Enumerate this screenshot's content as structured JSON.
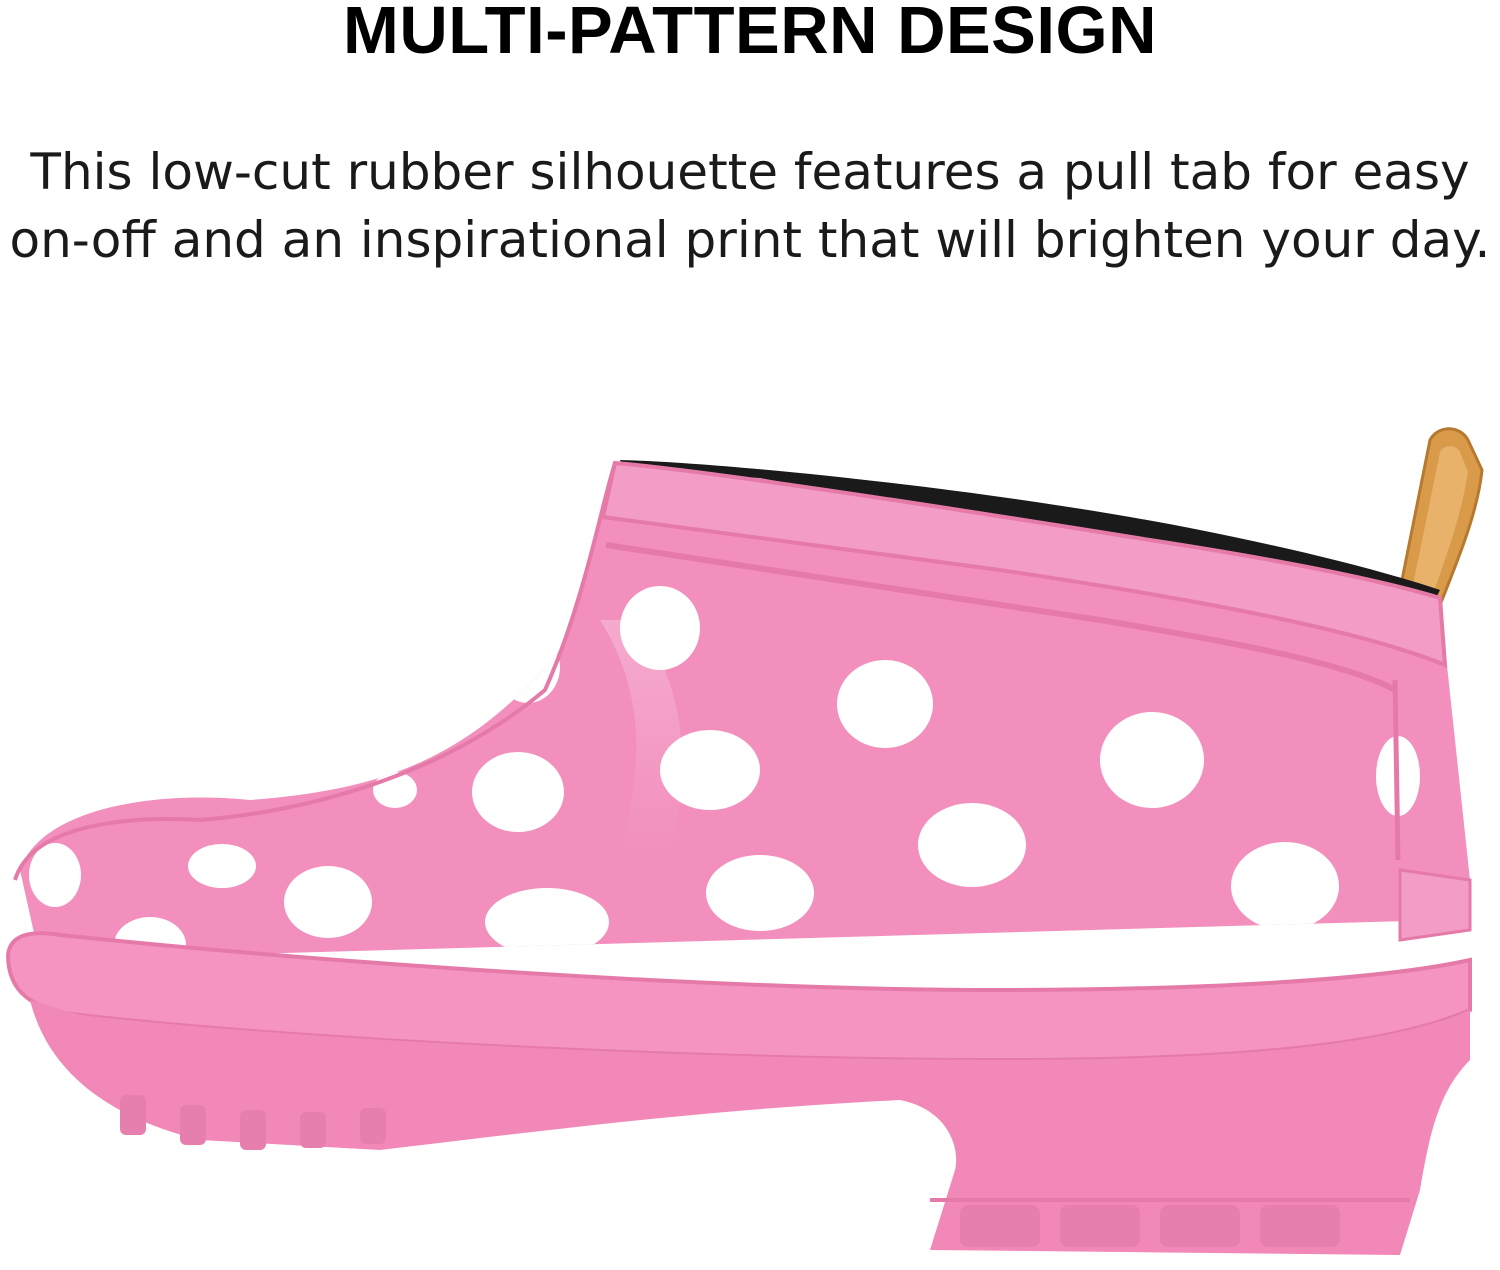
{
  "headline": "MULTI-PATTERN DESIGN",
  "description": {
    "line1": "This low-cut rubber silhouette features a pull tab for easy",
    "line2": "on-off and an inspirational print that will brighten your day."
  },
  "product_image": {
    "subject": "pink polka-dot low-cut rubber rain shoe with pull tab",
    "colors": {
      "shoe": "#f28fbd",
      "shoe_dark": "#e57aa9",
      "dots": "#ffffff",
      "lining": "#1a1a1a",
      "pull_tab": "#d99a4a"
    }
  }
}
